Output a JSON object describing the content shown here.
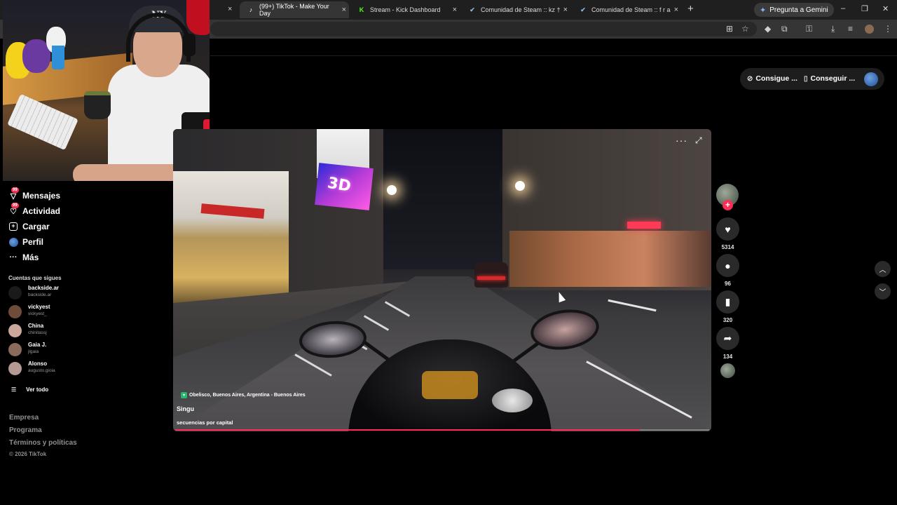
{
  "browser": {
    "tabs": [
      {
        "title": "(99+) TikTok - Make Your Day",
        "active": true,
        "favicon": "tiktok-icon"
      },
      {
        "title": "Stream - Kick Dashboard",
        "active": false,
        "favicon": "kick-icon"
      },
      {
        "title": "Comunidad de Steam :: kz †",
        "active": false,
        "favicon": "steam-icon"
      },
      {
        "title": "Comunidad de Steam :: f r a",
        "active": false,
        "favicon": "steam-icon"
      }
    ],
    "gemini_label": "Pregunta a Gemini",
    "new_tab_symbol": "+",
    "tab_close_symbol": "×"
  },
  "header": {
    "get_coins_label": "Consigue ...",
    "get_app_label": "Conseguir ..."
  },
  "sidebar": {
    "nav": [
      {
        "label": "Mensajes",
        "icon": "messages-icon",
        "badge": "99"
      },
      {
        "label": "Actividad",
        "icon": "activity-icon",
        "badge": "99"
      },
      {
        "label": "Cargar",
        "icon": "upload-icon",
        "badge": ""
      },
      {
        "label": "Perfil",
        "icon": "profile-icon",
        "badge": ""
      },
      {
        "label": "Más",
        "icon": "more-icon",
        "badge": ""
      }
    ],
    "following_title": "Cuentas que sigues",
    "following": [
      {
        "name": "backside.ar",
        "username": "backside.ar",
        "color": "#1a1a1a"
      },
      {
        "name": "vickyest",
        "username": "vickyest_",
        "color": "#6e4c3a"
      },
      {
        "name": "China",
        "username": "chinitassj",
        "color": "#c9a79a"
      },
      {
        "name": "Gaia J.",
        "username": "jlgaia",
        "color": "#8a6a5a"
      },
      {
        "name": "Alonso",
        "username": "augusto.gioia",
        "color": "#b49a92"
      }
    ],
    "see_all_label": "Ver todo",
    "footer": [
      "Empresa",
      "Programa",
      "Términos y políticas"
    ],
    "copyright": "© 2026 TikTok"
  },
  "video": {
    "location": "Obelisco, Buenos Aires, Argentina - Buenos Aires",
    "author": "Singu",
    "caption": "secuencias por capital",
    "billboard_text": "3D",
    "progress": 0.87
  },
  "actions": {
    "likes": "5314",
    "comments": "96",
    "saves": "320",
    "shares": "134"
  },
  "colors": {
    "accent": "#fe2c55",
    "background": "#000000"
  }
}
